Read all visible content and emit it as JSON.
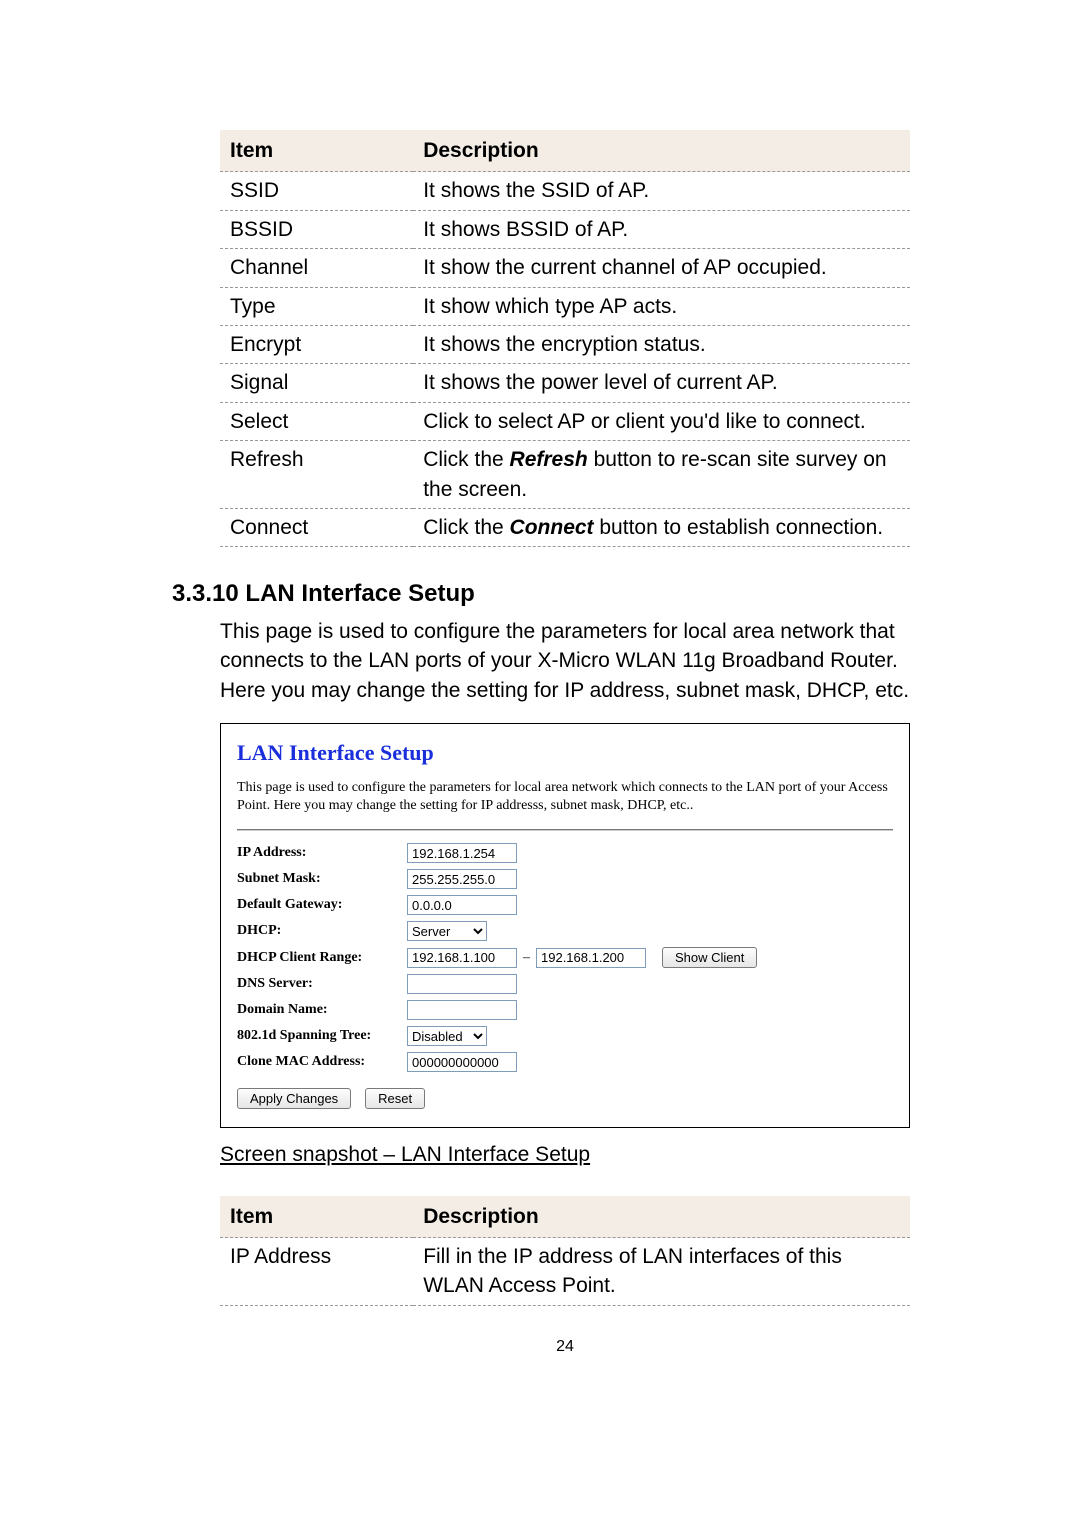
{
  "table1": {
    "headers": [
      "Item",
      "Description"
    ],
    "rows": [
      {
        "item": "SSID",
        "desc": "It shows the SSID of AP."
      },
      {
        "item": "BSSID",
        "desc": "It shows BSSID of AP."
      },
      {
        "item": "Channel",
        "desc": "It show the current channel of AP occupied."
      },
      {
        "item": "Type",
        "desc": "It show which type AP acts."
      },
      {
        "item": "Encrypt",
        "desc": "It shows the encryption status."
      },
      {
        "item": "Signal",
        "desc": "It shows the power level of current AP."
      },
      {
        "item": "Select",
        "desc": "Click to select AP or client you'd like to connect."
      },
      {
        "item": "Refresh",
        "desc_prefix": "Click the ",
        "desc_bold": "Refresh",
        "desc_suffix": " button to re-scan site survey on the screen."
      },
      {
        "item": "Connect",
        "desc_prefix": "Click the ",
        "desc_bold": "Connect",
        "desc_suffix": " button to establish connection."
      }
    ]
  },
  "section": {
    "number": "3.3.10",
    "title": "LAN Interface Setup",
    "body": "This page is used to configure the parameters for local area network that connects to the LAN ports of your X-Micro WLAN 11g Broadband Router. Here you may change the setting for IP address, subnet mask, DHCP, etc."
  },
  "panel": {
    "title": "LAN Interface Setup",
    "intro": "This page is used to configure the parameters for local area network which connects to the LAN port of your Access Point. Here you may change the setting for IP addresss, subnet mask, DHCP, etc..",
    "fields": {
      "ip_address_label": "IP Address:",
      "ip_address_value": "192.168.1.254",
      "subnet_mask_label": "Subnet Mask:",
      "subnet_mask_value": "255.255.255.0",
      "default_gateway_label": "Default Gateway:",
      "default_gateway_value": "0.0.0.0",
      "dhcp_label": "DHCP:",
      "dhcp_value": "Server",
      "client_range_label": "DHCP Client Range:",
      "client_range_start": "192.168.1.100",
      "client_range_end": "192.168.1.200",
      "show_client": "Show Client",
      "dns_server_label": "DNS Server:",
      "dns_server_value": "",
      "domain_name_label": "Domain Name:",
      "domain_name_value": "",
      "spanning_tree_label": "802.1d Spanning Tree:",
      "spanning_tree_value": "Disabled",
      "clone_mac_label": "Clone MAC Address:",
      "clone_mac_value": "000000000000",
      "apply": "Apply Changes",
      "reset": "Reset"
    }
  },
  "snapshot_caption": "Screen snapshot – LAN Interface Setup",
  "table2": {
    "headers": [
      "Item",
      "Description"
    ],
    "rows": [
      {
        "item": "IP Address",
        "desc": "Fill in the IP address of LAN interfaces of this WLAN Access Point."
      }
    ]
  },
  "page_number": "24"
}
